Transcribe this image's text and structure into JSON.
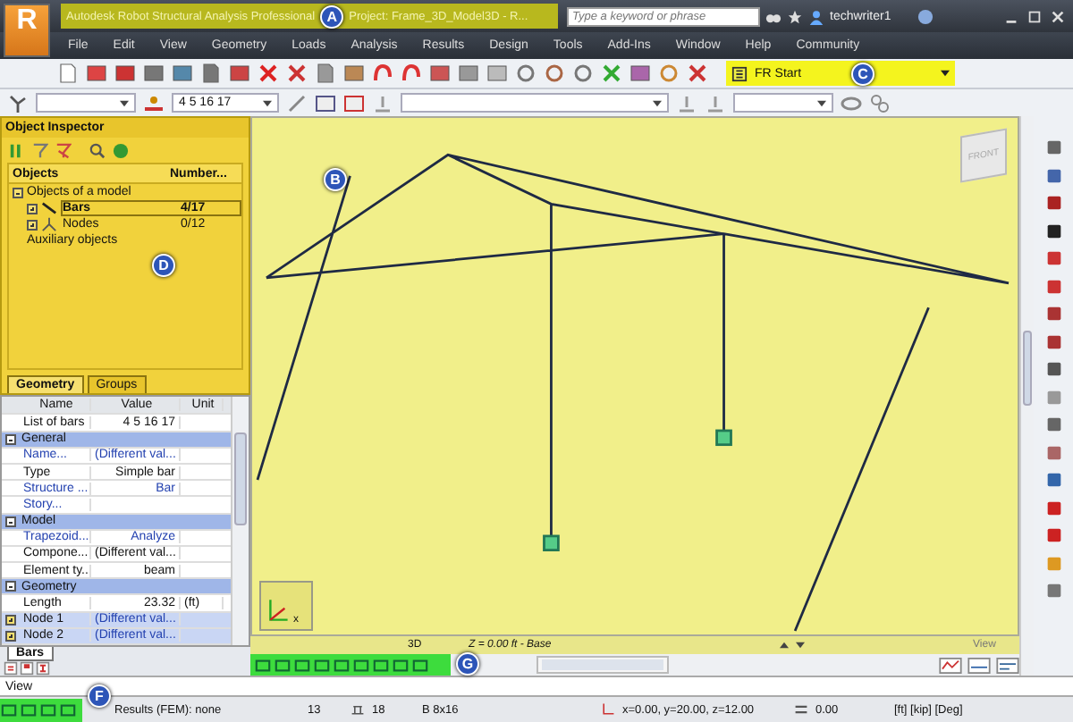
{
  "title_bar": {
    "logo": "R",
    "title": "Autodesk Robot Structural Analysis Professional",
    "project": "Project: Frame_3D_Model3D - R...",
    "search": {
      "placeholder": "Type a keyword or phrase"
    },
    "user": "techwriter1"
  },
  "menu": [
    "File",
    "Edit",
    "View",
    "Geometry",
    "Loads",
    "Analysis",
    "Results",
    "Design",
    "Tools",
    "Add-Ins",
    "Window",
    "Help",
    "Community"
  ],
  "toolbar": {
    "preset": "FR Start",
    "selection": "4 5 16 17"
  },
  "object_inspector": {
    "title": "Object Inspector",
    "columns": [
      "Objects",
      "Number..."
    ],
    "tree": [
      {
        "label": "Objects of a model",
        "expanded": true,
        "children": [
          {
            "label": "Bars",
            "count": "4/17",
            "selected": true
          },
          {
            "label": "Nodes",
            "count": "0/12",
            "selected": false
          }
        ]
      },
      {
        "label": "Auxiliary objects"
      }
    ],
    "tabs": [
      {
        "label": "Geometry",
        "selected": true
      },
      {
        "label": "Groups",
        "selected": false
      }
    ]
  },
  "properties": {
    "columns": [
      "Name",
      "Value",
      "Unit"
    ],
    "rows": [
      {
        "kind": "row",
        "name": "List of bars",
        "value": "4 5 16 17",
        "unit": "",
        "link": false,
        "selected": false,
        "expandable": false
      },
      {
        "kind": "section",
        "name": "General"
      },
      {
        "kind": "row",
        "name": "Name...",
        "value": "(Different val...",
        "unit": "",
        "link": true,
        "selected": false,
        "expandable": false
      },
      {
        "kind": "row",
        "name": "Type",
        "value": "Simple bar",
        "unit": "",
        "link": false,
        "selected": false,
        "expandable": false
      },
      {
        "kind": "row",
        "name": "Structure ...",
        "value": "Bar",
        "unit": "",
        "link": true,
        "selected": false,
        "expandable": false
      },
      {
        "kind": "row",
        "name": "Story...",
        "value": "",
        "unit": "",
        "link": true,
        "selected": false,
        "expandable": false
      },
      {
        "kind": "section",
        "name": "Model"
      },
      {
        "kind": "row",
        "name": "Trapezoid...",
        "value": "Analyze",
        "unit": "",
        "link": true,
        "selected": false,
        "expandable": false
      },
      {
        "kind": "row",
        "name": "Compone...",
        "value": "(Different val...",
        "unit": "",
        "link": false,
        "selected": false,
        "expandable": false
      },
      {
        "kind": "row",
        "name": "Element ty...",
        "value": "beam",
        "unit": "",
        "link": false,
        "selected": false,
        "expandable": false
      },
      {
        "kind": "section",
        "name": "Geometry"
      },
      {
        "kind": "row",
        "name": "Length",
        "value": "23.32",
        "unit": "(ft)",
        "link": false,
        "selected": false,
        "expandable": false
      },
      {
        "kind": "row",
        "name": "Node 1",
        "value": "(Different val...",
        "unit": "",
        "link": false,
        "selected": true,
        "expandable": true
      },
      {
        "kind": "row",
        "name": "Node 2",
        "value": "(Different val...",
        "unit": "",
        "link": false,
        "selected": true,
        "expandable": true
      }
    ],
    "tabs": [
      {
        "label": "Bars",
        "selected": true
      }
    ]
  },
  "viewport": {
    "view_cube": "FRONT",
    "axis": "x",
    "view": "3D",
    "level": "Z = 0.00 ft - Base",
    "view_label": "View"
  },
  "view_line": "View",
  "status_bar": {
    "results": "Results (FEM): none",
    "count": "13",
    "bars": "18",
    "section": "B 8x16",
    "coordinates": "x=0.00, y=20.00, z=12.00",
    "angle": "0.00",
    "units": "[ft] [kip] [Deg]"
  },
  "callouts": {
    "title": "A",
    "viewport": "B",
    "preset": "C",
    "inspector": "D",
    "status": "F",
    "view_toolbar": "G"
  }
}
